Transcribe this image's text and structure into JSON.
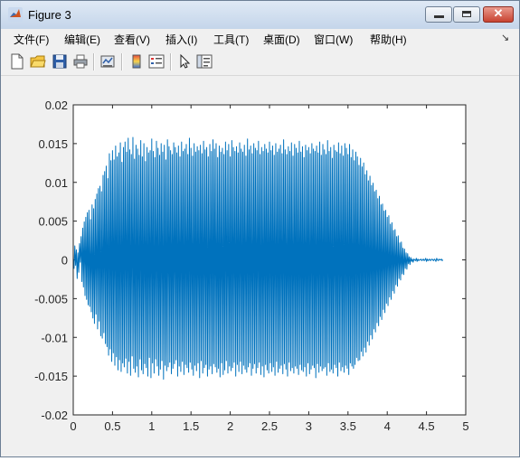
{
  "window": {
    "title": "Figure 3"
  },
  "menu": {
    "items": [
      {
        "label": "文件(F)"
      },
      {
        "label": "编辑(E)"
      },
      {
        "label": "查看(V)"
      },
      {
        "label": "插入(I)"
      },
      {
        "label": "工具(T)"
      },
      {
        "label": "桌面(D)"
      },
      {
        "label": "窗口(W)"
      },
      {
        "label": "帮助(H)"
      }
    ],
    "overflow_glyph": "↘"
  },
  "toolbar": {
    "icons": [
      "new-figure-icon",
      "open-file-icon",
      "save-icon",
      "print-icon",
      "link-plot-icon",
      "insert-colorbar-icon",
      "insert-legend-icon",
      "edit-plot-arrow-icon",
      "show-plot-tools-icon"
    ]
  },
  "colors": {
    "line": "#0072bd",
    "axes_bg": "#ffffff",
    "figure_bg": "#f0f0f0"
  },
  "chart_data": {
    "type": "line",
    "title": "",
    "xlabel": "",
    "ylabel": "",
    "xlim": [
      0,
      5
    ],
    "ylim": [
      -0.02,
      0.02
    ],
    "x_ticks": [
      "0",
      "0.5",
      "1",
      "1.5",
      "2",
      "2.5",
      "3",
      "3.5",
      "4",
      "4.5",
      "5"
    ],
    "y_ticks": [
      "0.02",
      "0.015",
      "0.01",
      "0.005",
      "0",
      "-0.005",
      "-0.01",
      "-0.015",
      "-0.02"
    ],
    "grid": false,
    "series": [
      {
        "sample_interval": 0.01,
        "x_start": 0,
        "values": [
          0.0002,
          -0.0011,
          0.0018,
          -0.0007,
          0.0013,
          -0.0024,
          0.0009,
          -0.0016,
          0.0021,
          -0.0003,
          0.003,
          -0.0028,
          0.0041,
          -0.0035,
          0.0049,
          -0.0046,
          0.0055,
          -0.0051,
          0.0061,
          -0.0058,
          0.0064,
          -0.006,
          0.0052,
          -0.0067,
          0.0071,
          -0.0075,
          0.0066,
          -0.0082,
          0.0078,
          -0.007,
          0.0085,
          -0.0089,
          0.0092,
          -0.0079,
          0.0095,
          -0.0098,
          0.0088,
          -0.0101,
          0.0109,
          -0.0094,
          0.0114,
          -0.0108,
          0.0121,
          -0.0112,
          0.0105,
          -0.0123,
          0.0137,
          -0.0115,
          0.0128,
          -0.0131,
          0.0141,
          -0.012,
          0.0129,
          -0.0136,
          0.0147,
          -0.0125,
          0.0133,
          -0.0142,
          0.0138,
          -0.0129,
          0.0151,
          -0.0144,
          0.0126,
          -0.0133,
          0.0145,
          -0.0138,
          0.0152,
          -0.0127,
          0.0139,
          -0.0146,
          0.0157,
          -0.0131,
          0.0142,
          -0.0149,
          0.0136,
          -0.0124,
          0.0158,
          -0.014,
          0.013,
          -0.0145,
          0.0148,
          -0.0137,
          0.0143,
          -0.0151,
          0.0135,
          -0.0128,
          0.0154,
          -0.0142,
          0.0133,
          -0.0147,
          0.015,
          -0.0134,
          0.0127,
          -0.0139,
          0.0145,
          -0.015,
          0.0138,
          -0.0126,
          0.0141,
          -0.0152,
          0.0156,
          -0.0133,
          0.014,
          -0.0146,
          0.0132,
          -0.0128,
          0.0153,
          -0.0137,
          0.0144,
          -0.0149,
          0.0135,
          -0.0141,
          0.015,
          -0.013,
          0.0139,
          -0.0154,
          0.0148,
          -0.0136,
          0.0129,
          -0.0143,
          0.0155,
          -0.0138,
          0.0146,
          -0.0132,
          0.0141,
          -0.0147,
          0.0136,
          -0.014,
          0.0151,
          -0.0134,
          0.0145,
          -0.0129,
          0.0138,
          -0.015,
          0.0147,
          -0.0137,
          0.0133,
          -0.0144,
          0.0152,
          -0.0131,
          0.014,
          -0.0148,
          0.0143,
          -0.0135,
          0.0149,
          -0.0139,
          0.0136,
          -0.0145,
          0.0157,
          -0.0132,
          0.0144,
          -0.0141,
          0.0134,
          -0.0149,
          0.015,
          -0.0136,
          0.0139,
          -0.0143,
          0.0146,
          -0.0133,
          0.0141,
          -0.0152,
          0.0148,
          -0.013,
          0.0137,
          -0.0146,
          0.0153,
          -0.0139,
          0.0142,
          -0.0135,
          0.0145,
          -0.015,
          0.0133,
          -0.0141,
          0.0149,
          -0.0137,
          0.014,
          -0.0147,
          0.0155,
          -0.0134,
          0.0143,
          -0.0138,
          0.015,
          -0.0145,
          0.0132,
          -0.014,
          0.0147,
          -0.0151,
          0.0139,
          -0.0133,
          0.0144,
          -0.0148,
          0.0136,
          -0.0142,
          0.0152,
          -0.013,
          0.0141,
          -0.0146,
          0.0149,
          -0.0137,
          0.0133,
          -0.0143,
          0.0154,
          -0.0139,
          0.0145,
          -0.0132,
          0.014,
          -0.015,
          0.0146,
          -0.0135,
          0.0138,
          -0.0144,
          0.0151,
          -0.0131,
          0.0143,
          -0.0147,
          0.0139,
          -0.0136,
          0.0148,
          -0.0141,
          0.0134,
          -0.0145,
          0.0156,
          -0.0138,
          0.0142,
          -0.0133,
          0.0147,
          -0.0149,
          0.0137,
          -0.014,
          0.015,
          -0.0134,
          0.0144,
          -0.0146,
          0.0141,
          -0.0139,
          0.0153,
          -0.0132,
          0.0136,
          -0.0148,
          0.0145,
          -0.0137,
          0.014,
          -0.0151,
          0.0149,
          -0.0135,
          0.0143,
          -0.0142,
          0.0138,
          -0.0146,
          0.0152,
          -0.0133,
          0.0141,
          -0.0144,
          0.0147,
          -0.0138,
          0.0135,
          -0.0149,
          0.015,
          -0.0131,
          0.0139,
          -0.0145,
          0.0143,
          -0.014,
          0.0148,
          -0.0136,
          0.0137,
          -0.0147,
          0.0155,
          -0.0134,
          0.0142,
          -0.0141,
          0.0136,
          -0.015,
          0.0146,
          -0.0132,
          0.014,
          -0.0143,
          0.0151,
          -0.0139,
          0.0134,
          -0.0146,
          0.0149,
          -0.0137,
          0.0144,
          -0.014,
          0.0138,
          -0.0148,
          0.0153,
          -0.0135,
          0.0139,
          -0.0142,
          0.0146,
          -0.0144,
          0.0132,
          -0.0138,
          0.0148,
          -0.015,
          0.0141,
          -0.0133,
          0.0145,
          -0.0147,
          0.0137,
          -0.0141,
          0.015,
          -0.0136,
          0.0143,
          -0.0139,
          0.014,
          -0.0152,
          0.0147,
          -0.0134,
          0.0138,
          -0.0145,
          0.0152,
          -0.0137,
          0.0135,
          -0.0143,
          0.0149,
          -0.014,
          0.0142,
          -0.0138,
          0.0136,
          -0.0149,
          0.0154,
          -0.0133,
          0.014,
          -0.0144,
          0.0145,
          -0.0141,
          0.0131,
          -0.0146,
          0.0148,
          -0.0135,
          0.0141,
          -0.0139,
          0.0139,
          -0.015,
          0.0151,
          -0.0132,
          0.0137,
          -0.0143,
          0.0147,
          -0.0138,
          0.0134,
          -0.0145,
          0.015,
          -0.0136,
          0.0144,
          -0.014,
          0.0136,
          -0.0148,
          0.0149,
          -0.0133,
          0.0132,
          -0.0137,
          0.0142,
          -0.014,
          0.0128,
          -0.0135,
          0.0139,
          -0.0126,
          0.0133,
          -0.013,
          0.0122,
          -0.0129,
          0.0131,
          -0.0118,
          0.012,
          -0.0124,
          0.0125,
          -0.0113,
          0.011,
          -0.0119,
          0.0115,
          -0.0105,
          0.0102,
          -0.011,
          0.0108,
          -0.0097,
          0.0096,
          -0.0102,
          0.0099,
          -0.0089,
          0.0088,
          -0.0093,
          0.009,
          -0.0081,
          0.0079,
          -0.0085,
          0.0082,
          -0.0073,
          0.0071,
          -0.0077,
          0.0072,
          -0.0064,
          0.0063,
          -0.0068,
          0.0064,
          -0.0056,
          0.0055,
          -0.0059,
          0.0057,
          -0.0048,
          0.0046,
          -0.0051,
          0.0048,
          -0.004,
          0.0038,
          -0.0043,
          0.0039,
          -0.0032,
          0.003,
          -0.0034,
          0.0031,
          -0.0024,
          0.0022,
          -0.0026,
          0.0023,
          -0.0018,
          0.0015,
          -0.0019,
          0.0014,
          -0.0011,
          0.0009,
          -0.0012,
          0.0008,
          -0.0005,
          0.0004,
          -0.0006,
          0.0003,
          -0.0002,
          0.0001,
          -0.0003,
          0.0001,
          0.0,
          -0.0001,
          0.0002,
          -0.0002,
          0.0001,
          -0.0001,
          0.0,
          0.0,
          0.0001,
          -0.0001,
          0.0,
          0.0001,
          -0.0001,
          0.0,
          0.0002,
          -0.0002,
          0.0001,
          -0.0001,
          0.0,
          0.0001,
          -0.0001,
          0.0,
          0.0001,
          0.0,
          -0.0001,
          0.0001,
          0.0,
          -0.0002,
          0.0002,
          0.0,
          -0.0001,
          0.0001,
          0.0,
          0.0,
          0.0001,
          -0.0001,
          0.0
        ]
      }
    ]
  }
}
